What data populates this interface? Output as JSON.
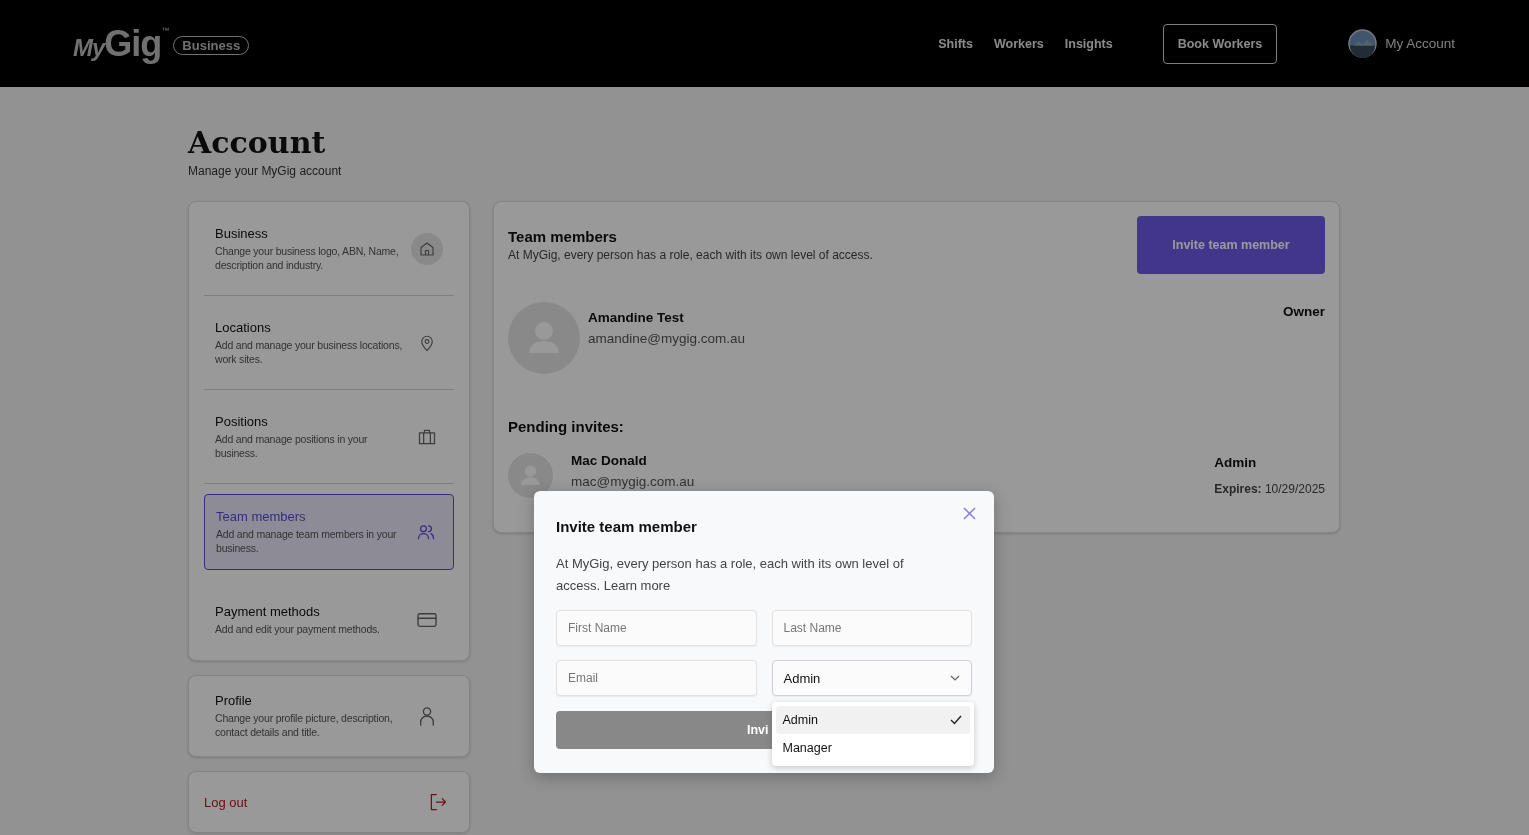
{
  "header": {
    "logo": {
      "script": "My",
      "word": "Gig",
      "mark": "™",
      "badge": "Business"
    },
    "nav": [
      "Shifts",
      "Workers",
      "Insights"
    ],
    "book_button": "Book Workers",
    "account": "My Account"
  },
  "page": {
    "title": "Account",
    "subtitle": "Manage your MyGig account"
  },
  "sidebar": {
    "cards": [
      {
        "items": [
          {
            "kind": "home",
            "title": "Business",
            "description": "Change your business logo, ABN, Name, description and industry.",
            "selected": false,
            "hovered": true
          },
          {
            "kind": "pin",
            "title": "Locations",
            "description": "Add and manage your business locations, work sites.",
            "selected": false,
            "hovered": false
          },
          {
            "kind": "briefcase",
            "title": "Positions",
            "description": "Add and manage positions in your business.",
            "selected": false,
            "hovered": false
          },
          {
            "kind": "users",
            "title": "Team members",
            "description": "Add and manage team members in your business.",
            "selected": true,
            "hovered": false
          },
          {
            "kind": "card",
            "title": "Payment methods",
            "description": "Add and edit your payment methods.",
            "selected": false,
            "hovered": false
          }
        ]
      },
      {
        "items": [
          {
            "kind": "user",
            "title": "Profile",
            "description": "Change your profile picture, description, contact details and title.",
            "selected": false,
            "hovered": false
          }
        ]
      },
      {
        "items": [
          {
            "kind": "logout",
            "title": "Log out",
            "selected": false,
            "hovered": false
          }
        ]
      }
    ]
  },
  "team": {
    "title": "Team members",
    "description": "At MyGig, every person has a role, each with its own level of access.",
    "invite_button": "Invite team member",
    "members": [
      {
        "name": "Amandine Test",
        "email": "amandine@mygig.com.au",
        "role": "Owner"
      }
    ],
    "pending_title": "Pending invites:",
    "pending": [
      {
        "name": "Mac Donald",
        "email": "mac@mygig.com.au",
        "role": "Admin",
        "expires_label": "Expires:",
        "expires_value": "10/29/2025"
      }
    ]
  },
  "modal": {
    "title": "Invite team member",
    "description": "At MyGig, every person has a role, each with its own level of access.",
    "link": "Learn more",
    "fields": [
      {
        "placeholder": "First Name"
      },
      {
        "placeholder": "Last Name"
      },
      {
        "placeholder": "Email"
      }
    ],
    "role_select": {
      "value": "Admin",
      "expanded": true,
      "options": [
        {
          "label": "Admin",
          "selected": true
        },
        {
          "label": "Manager",
          "selected": false
        }
      ]
    },
    "submit": "Invi"
  }
}
